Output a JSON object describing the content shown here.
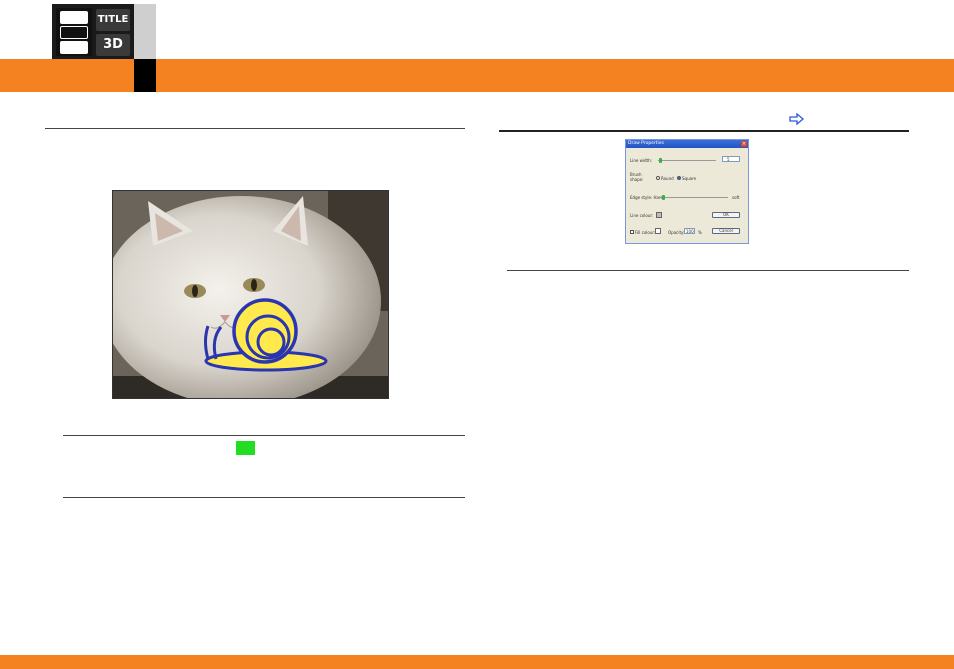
{
  "header": {
    "logo": {
      "title_text": "TITLE",
      "badge_text": "3D",
      "icon": "film-strip-icon"
    },
    "accent_color": "#f58220"
  },
  "navigation": {
    "next_icon": "arrow-right-icon"
  },
  "left": {
    "photo": {
      "subject": "white persian cat with yellow snail drawing",
      "overlay_colors": {
        "stroke": "#2a35b0",
        "fill": "#ffe94d"
      }
    },
    "green_marker_color": "#22dd22"
  },
  "dialog": {
    "title": "Draw Properties",
    "line_width_label": "Line width:",
    "line_width_value": "5",
    "brush_shape_label": "Brush shape:",
    "brush_options": [
      "Round",
      "Square"
    ],
    "brush_selected": "Square",
    "edge_label": "Edge style: Hard",
    "edge_end_label": "soft",
    "line_colour_label": "Line colour:",
    "fill_label": "Fill colour:",
    "opacity_label": "Opacity:",
    "opacity_value": "100",
    "opacity_unit": "%",
    "ok_label": "OK",
    "cancel_label": "Cancel"
  }
}
